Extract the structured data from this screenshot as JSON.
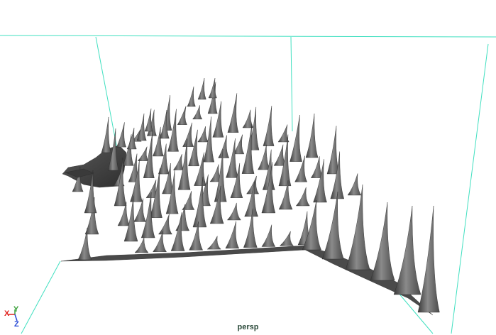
{
  "viewport": {
    "camera_name": "persp",
    "background_color": "#ffffff",
    "grid_color": "#40e0c0",
    "surface_color": "#6e6e6e",
    "surface_shadow_color": "#3a3a3a",
    "surface_highlight_color": "#a8a8a8"
  },
  "axis_gizmo": {
    "x_label": "X",
    "y_label": "Y",
    "z_label": "Z",
    "x_color": "#e0201c",
    "y_color": "#3aa13a",
    "z_color": "#2346d6"
  }
}
